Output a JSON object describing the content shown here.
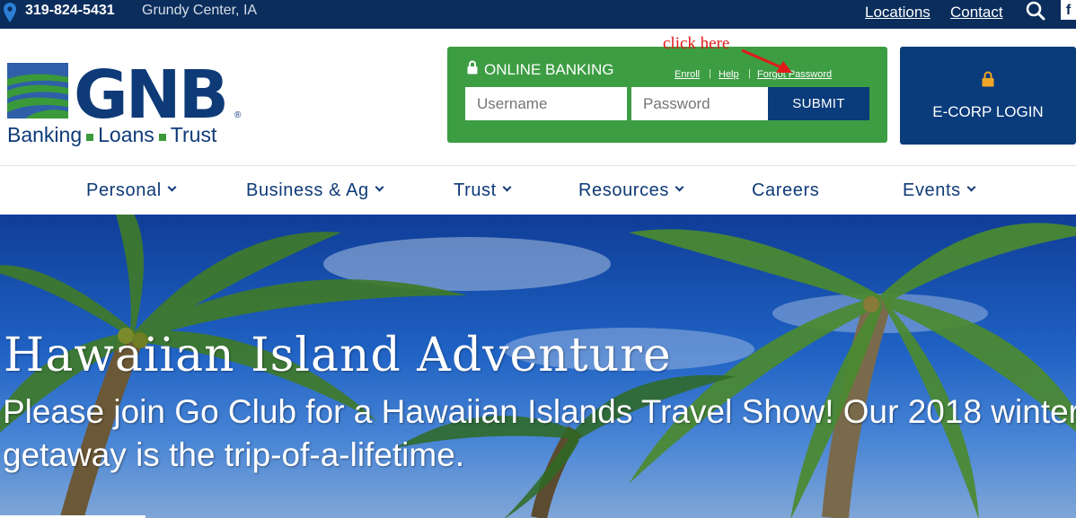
{
  "topbar": {
    "phone": "319-824-5431",
    "city": "Grundy Center, IA",
    "locations": "Locations",
    "contact": "Contact",
    "facebook": "f"
  },
  "brand": {
    "name": "GNB",
    "registered": "®",
    "tagline": [
      "Banking",
      "Loans",
      "Trust"
    ],
    "colors": {
      "navy": "#0e3a78",
      "green": "#3a9a3a"
    }
  },
  "online_banking": {
    "title": "ONLINE BANKING",
    "links": [
      "Enroll",
      "Help",
      "Forgot Password"
    ],
    "username_placeholder": "Username",
    "password_placeholder": "Password",
    "submit": "SUBMIT"
  },
  "ecorp": {
    "label": "E-CORP LOGIN"
  },
  "annotation": {
    "text": "click here",
    "color": "#e11a1a"
  },
  "nav": [
    {
      "label": "Personal",
      "dropdown": true
    },
    {
      "label": "Business & Ag",
      "dropdown": true
    },
    {
      "label": "Trust",
      "dropdown": true
    },
    {
      "label": "Resources",
      "dropdown": true
    },
    {
      "label": "Careers",
      "dropdown": false
    },
    {
      "label": "Events",
      "dropdown": true
    }
  ],
  "hero": {
    "title": "Hawaiian Island Adventure",
    "text": "Please join Go Club for a Hawaiian Islands Travel Show! Our 2018 winter getaway is the trip-of-a-lifetime."
  }
}
